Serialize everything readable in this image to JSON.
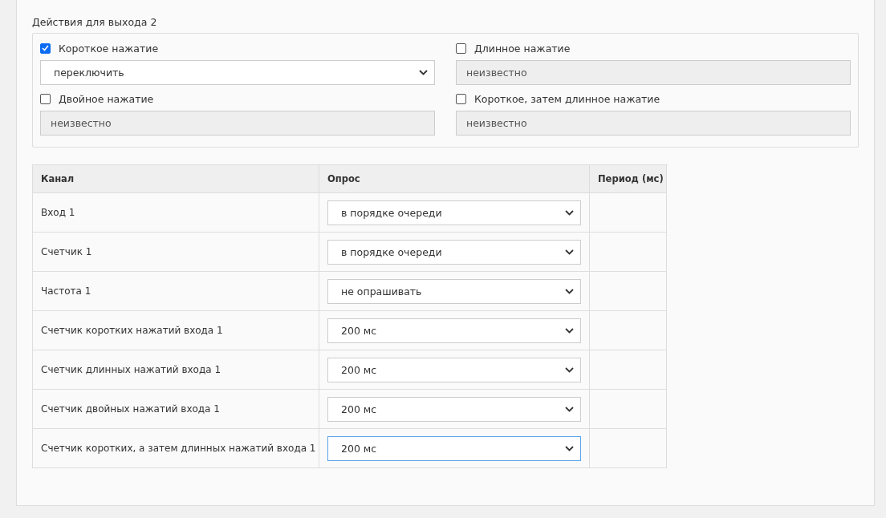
{
  "actions": {
    "title": "Действия для выхода 2",
    "items": [
      {
        "label": "Короткое нажатие",
        "checked": true,
        "value": "переключить"
      },
      {
        "label": "Длинное нажатие",
        "checked": false,
        "value": "неизвестно"
      },
      {
        "label": "Двойное нажатие",
        "checked": false,
        "value": "неизвестно"
      },
      {
        "label": "Короткое, затем длинное нажатие",
        "checked": false,
        "value": "неизвестно"
      }
    ]
  },
  "table": {
    "columns": [
      "Канал",
      "Опрос",
      "Период (мс)"
    ],
    "rows": [
      {
        "channel": "Вход 1",
        "poll": "в порядке очереди",
        "focused": false
      },
      {
        "channel": "Счетчик 1",
        "poll": "в порядке очереди",
        "focused": false
      },
      {
        "channel": "Частота 1",
        "poll": "не опрашивать",
        "focused": false
      },
      {
        "channel": "Счетчик коротких нажатий входа 1",
        "poll": "200 мс",
        "focused": false
      },
      {
        "channel": "Счетчик длинных нажатий входа 1",
        "poll": "200 мс",
        "focused": false
      },
      {
        "channel": "Счетчик двойных нажатий входа 1",
        "poll": "200 мс",
        "focused": false
      },
      {
        "channel": "Счетчик коротких, а затем длинных нажатий входа 1",
        "poll": "200 мс",
        "focused": true
      }
    ]
  }
}
